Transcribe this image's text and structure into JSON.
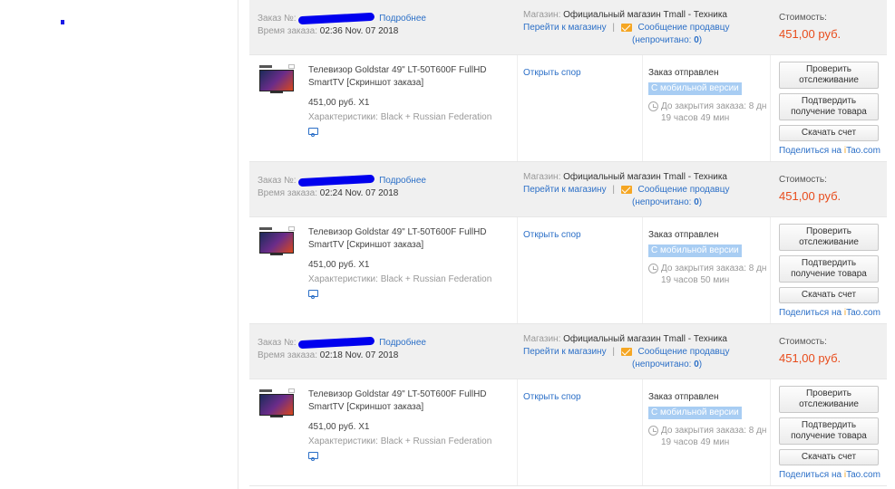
{
  "labels": {
    "order_no": "Заказ №:",
    "more": "Подробнее",
    "order_time": "Время заказа:",
    "shop_label": "Магазин:",
    "shop_name": "Официальный магазин Tmall - Техника",
    "goto_shop": "Перейти к магазину",
    "separator": "|",
    "message_seller": "Сообщение продавцу",
    "unread_prefix": "(непрочитано: ",
    "unread_suffix": ")",
    "cost_label": "Стоимость:",
    "open_dispute": "Открыть спор",
    "track_button": "Проверить отслеживание",
    "confirm_button": "Подтвердить получение товара",
    "invoice_button": "Скачать счет",
    "share_prefix": "Поделиться на ",
    "share_i": "i",
    "share_tao": "Tao.com"
  },
  "orders": [
    {
      "time": "02:36 Nov. 07 2018",
      "unread": "0",
      "cost": "451,00 руб.",
      "product_title": "Телевизор Goldstar 49\" LT-50T600F FullHD SmartTV [Скриншот заказа]",
      "price_qty": "451,00 руб. X1",
      "characteristics": "Характеристики: Black + Russian Federation",
      "status": "Заказ отправлен",
      "mobile_badge": "С мобильной версии",
      "timer": "До закрытия заказа: 8 дн 19 часов 49 мин"
    },
    {
      "time": "02:24 Nov. 07 2018",
      "unread": "0",
      "cost": "451,00 руб.",
      "product_title": "Телевизор Goldstar 49\" LT-50T600F FullHD SmartTV [Скриншот заказа]",
      "price_qty": "451,00 руб. X1",
      "characteristics": "Характеристики: Black + Russian Federation",
      "status": "Заказ отправлен",
      "mobile_badge": "С мобильной версии",
      "timer": "До закрытия заказа: 8 дн 19 часов 50 мин"
    },
    {
      "time": "02:18 Nov. 07 2018",
      "unread": "0",
      "cost": "451,00 руб.",
      "product_title": "Телевизор Goldstar 49\" LT-50T600F FullHD SmartTV [Скриншот заказа]",
      "price_qty": "451,00 руб. X1",
      "characteristics": "Характеристики: Black + Russian Federation",
      "status": "Заказ отправлен",
      "mobile_badge": "С мобильной версии",
      "timer": "До закрытия заказа: 8 дн 19 часов 49 мин"
    }
  ],
  "colors": {
    "link": "#2b6fc7",
    "cost": "#e84c1c",
    "badge": "#a8cdf3",
    "mail_icon": "#f5a623",
    "redaction": "#0000ee"
  }
}
